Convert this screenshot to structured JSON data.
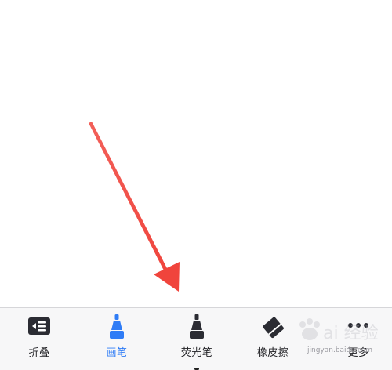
{
  "toolbar": {
    "items": [
      {
        "label": "折叠",
        "icon": "collapse-list-icon",
        "active": false
      },
      {
        "label": "画笔",
        "icon": "pen-icon",
        "active": true
      },
      {
        "label": "荧光笔",
        "icon": "highlighter-icon",
        "active": false
      },
      {
        "label": "橡皮擦",
        "icon": "eraser-icon",
        "active": false
      },
      {
        "label": "更多",
        "icon": "more-dots-icon",
        "active": false
      }
    ]
  },
  "watermark": {
    "caption": "jingyan.baidu.com"
  },
  "colors": {
    "active": "#2f7cf6",
    "icon_dark": "#2b2c33",
    "annotation_arrow": "#f0443c",
    "toolbar_bg": "#f7f7f8"
  }
}
